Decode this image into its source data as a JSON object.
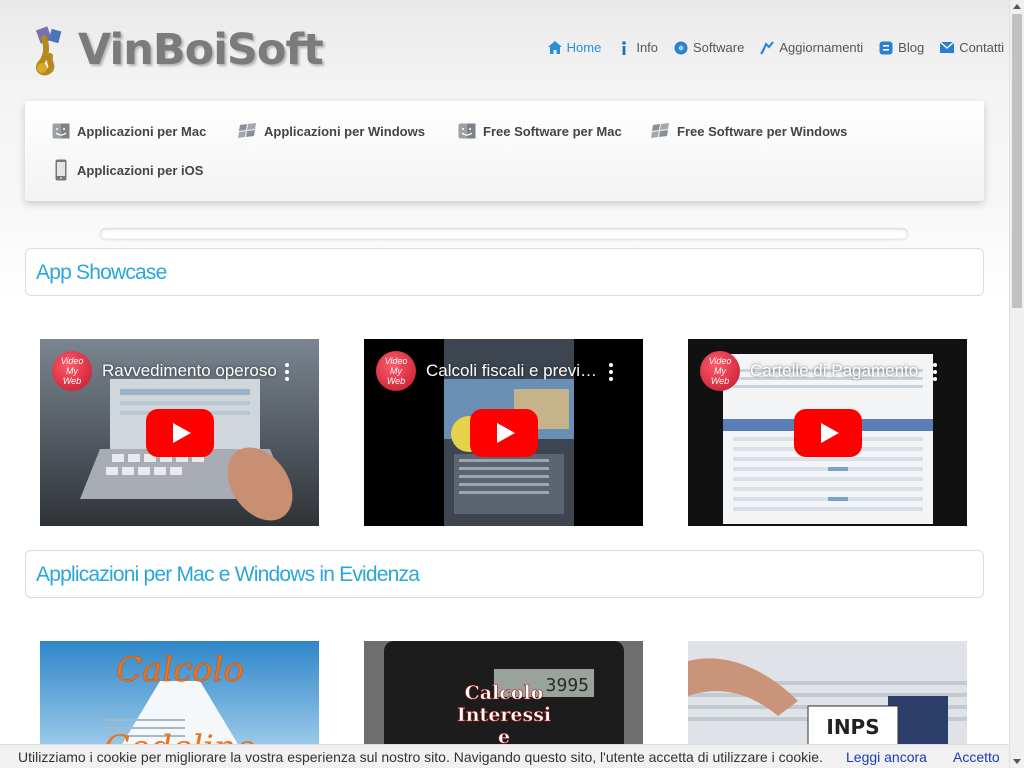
{
  "brand": {
    "name": "VinBoiSoft"
  },
  "topnav": [
    {
      "label": "Home",
      "icon": "home-icon",
      "active": true
    },
    {
      "label": "Info",
      "icon": "info-icon"
    },
    {
      "label": "Software",
      "icon": "software-icon"
    },
    {
      "label": "Aggiornamenti",
      "icon": "update-icon"
    },
    {
      "label": "Blog",
      "icon": "blog-icon"
    },
    {
      "label": "Contatti",
      "icon": "mail-icon"
    }
  ],
  "categories": [
    {
      "label": "Applicazioni per Mac",
      "icon": "mac-finder-icon"
    },
    {
      "label": "Applicazioni per Windows",
      "icon": "windows-icon"
    },
    {
      "label": "Free Software per Mac",
      "icon": "mac-finder-icon"
    },
    {
      "label": "Free Software per Windows",
      "icon": "windows-icon"
    },
    {
      "label": "Applicazioni per iOS",
      "icon": "iphone-icon"
    }
  ],
  "sections": {
    "showcase": "App Showcase",
    "featured": "Applicazioni per Mac e Windows in Evidenza"
  },
  "videos": [
    {
      "title": "Ravvedimento operoso",
      "channel": "Video My Web"
    },
    {
      "title": "Calcoli fiscali e previdenziali",
      "channel": "Video My Web"
    },
    {
      "title": "Cartelle di Pagamento",
      "channel": "Video My Web"
    }
  ],
  "featured": [
    {
      "title": "Calcolo Codelino",
      "text1": "Calcolo",
      "text2": "Codelino"
    },
    {
      "title": "Calcolo Interessi e",
      "text1": "Calcolo",
      "text2": "Interessi",
      "text3": "e",
      "display": "3995"
    },
    {
      "title": "Cedolini INPS",
      "text1": "INPS"
    }
  ],
  "cookie": {
    "message": "Utilizziamo i cookie per migliorare la vostra esperienza sul nostro sito. Navigando questo sito, l'utente accetta di utilizzare i cookie.",
    "more": "Leggi ancora",
    "accept": "Accetto"
  },
  "colors": {
    "accent": "#2aa6db",
    "active_nav": "#2a8fd6",
    "link": "#1a3cb4",
    "youtube_red": "#ff0000"
  }
}
